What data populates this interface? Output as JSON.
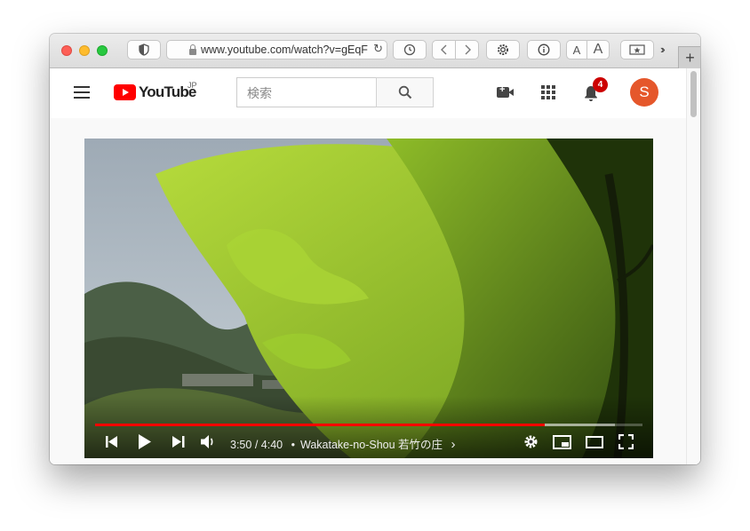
{
  "browser": {
    "url": "www.youtube.com/watch?v=gEqF",
    "font_small": "A",
    "font_large": "A"
  },
  "header": {
    "logo_text": "YouTube",
    "region": "JP",
    "search_placeholder": "検索",
    "notification_count": "4",
    "avatar_letter": "S"
  },
  "player": {
    "current_time": "3:50",
    "duration": "4:40",
    "time_separator": "/",
    "chapter_dot": "•",
    "title": "Wakatake-no-Shou 若竹の庄",
    "title_chevron": "›",
    "progress_fraction": 0.8214,
    "buffered_fraction": 0.95,
    "accent_color": "#ff0000"
  },
  "colors": {
    "avatar_bg": "#e5572b",
    "badge_bg": "#cc0000",
    "logo_red": "#ff0000"
  }
}
